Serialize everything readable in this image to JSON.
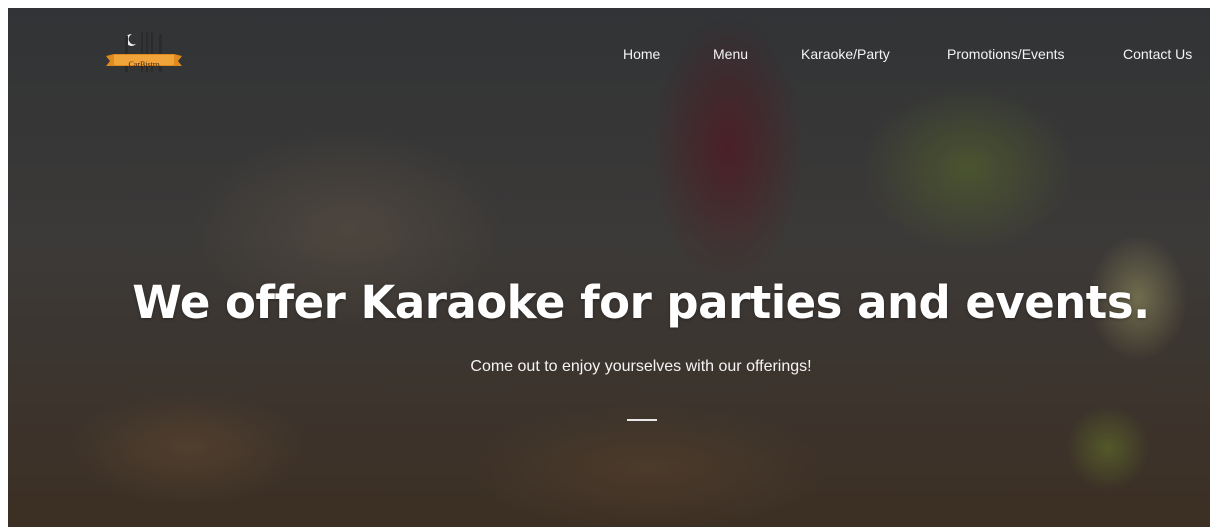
{
  "logo": {
    "text": "CarBistro",
    "icon": "fork-knife-moon-logo"
  },
  "nav": {
    "items": [
      {
        "label": "Home"
      },
      {
        "label": "Menu"
      },
      {
        "label": "Karaoke/Party"
      },
      {
        "label": "Promotions/Events"
      },
      {
        "label": "Contact Us"
      }
    ]
  },
  "hero": {
    "headline": "We offer Karaoke for parties and events.",
    "subheadline": "Come out to enjoy yourselves with our offerings!"
  },
  "colors": {
    "text": "#ffffff",
    "logo_banner": "#e08a1e"
  }
}
